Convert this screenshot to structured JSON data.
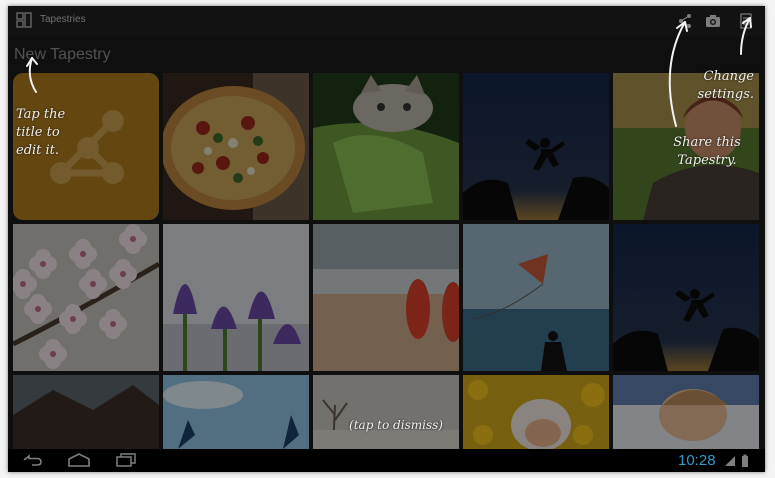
{
  "app": {
    "title": "Tapestries",
    "tapestry_title": "New Tapestry",
    "icons": {
      "app": "app-grid-icon",
      "share": "share-icon",
      "camera": "camera-icon",
      "overflow": "overflow-menu-icon"
    }
  },
  "annotations": {
    "title_hint": "Tap the\ntitle to\nedit it.",
    "settings_hint": "Change\nsettings.",
    "share_hint": "Share this\nTapestry.",
    "dismiss_hint": "(tap to dismiss)"
  },
  "tiles": [
    {
      "name": "share-tile",
      "desc": "share"
    },
    {
      "name": "pizza",
      "desc": "pizza"
    },
    {
      "name": "kitten",
      "desc": "kitten"
    },
    {
      "name": "jumper-silhouette",
      "desc": "jumper"
    },
    {
      "name": "child-portrait",
      "desc": "child"
    },
    {
      "name": "cherry-blossoms",
      "desc": "blossom"
    },
    {
      "name": "crocuses",
      "desc": "crocus"
    },
    {
      "name": "beach-sandals",
      "desc": "sandals"
    },
    {
      "name": "kite-over-sea",
      "desc": "kite"
    },
    {
      "name": "jumper-silhouette-2",
      "desc": "jumper"
    },
    {
      "name": "mountains",
      "desc": "mountain"
    },
    {
      "name": "sky-hands",
      "desc": "sky"
    },
    {
      "name": "winter-tree",
      "desc": "tree"
    },
    {
      "name": "girl-in-flowers",
      "desc": "girl"
    },
    {
      "name": "sleeping-baby",
      "desc": "baby"
    }
  ],
  "navbar": {
    "time": "10:28",
    "icons": {
      "back": "back-icon",
      "home": "home-icon",
      "recent": "recent-apps-icon",
      "battery": "battery-icon",
      "signal": "signal-icon"
    }
  },
  "colors": {
    "accent": "#35a9de",
    "share_tile": "#b07a1f"
  }
}
